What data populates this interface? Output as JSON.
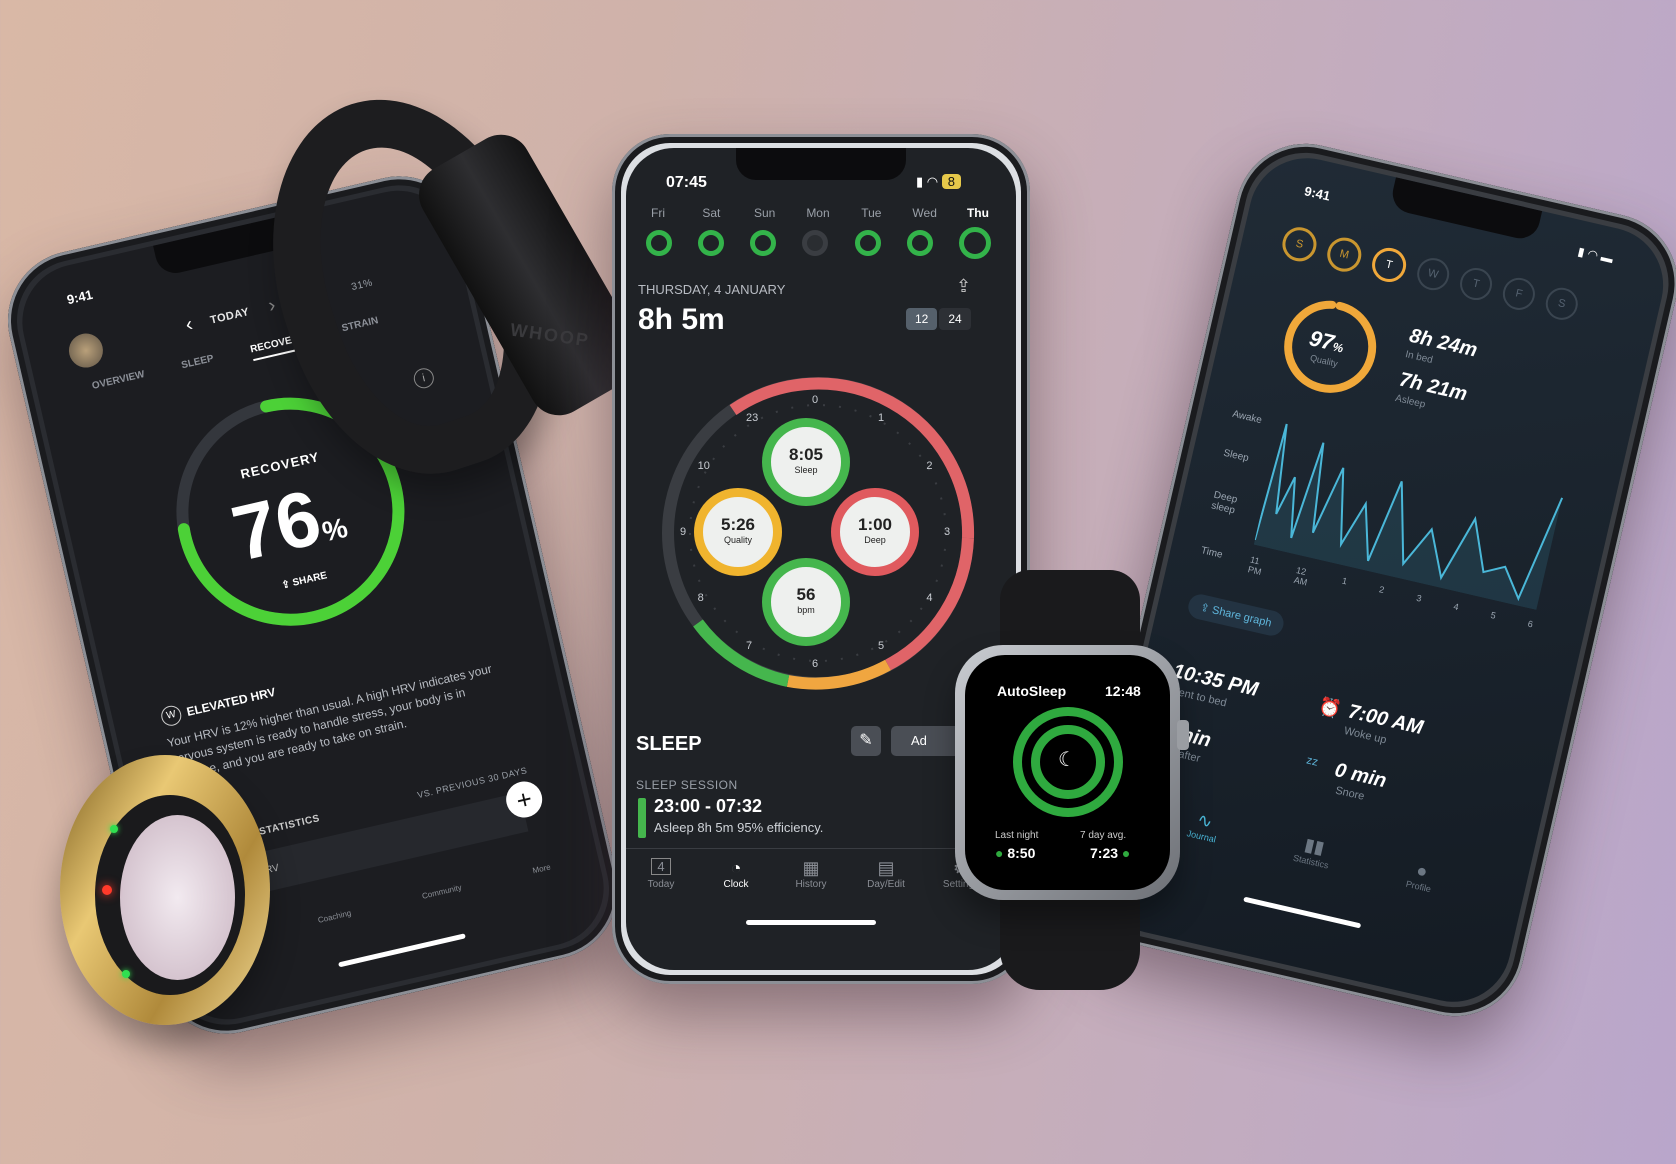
{
  "whoop_phone": {
    "time": "9:41",
    "nav_label": "TODAY",
    "battery": "31%",
    "tabs": [
      "OVERVIEW",
      "SLEEP",
      "RECOVERY",
      "STRAIN"
    ],
    "recovery_label": "RECOVERY",
    "recovery_value": "76",
    "recovery_unit": "%",
    "recovery_fraction": 0.76,
    "share_label": "SHARE",
    "hrv_title": "ELEVATED HRV",
    "hrv_text": "Your HRV is 12% higher than usual. A high HRV indicates your nervous system is ready to handle stress, your body is in balance, and you are ready to take on strain.",
    "stats_label": "RY STATISTICS",
    "stats_compare": "VS. PREVIOUS 30 DAYS",
    "stats_row": "RV",
    "bottom_nav": [
      "ome",
      "Coaching",
      "Community",
      "More"
    ],
    "accent": "#4cd137"
  },
  "band": {
    "brand": "WHOOP"
  },
  "autosleep_phone": {
    "time": "07:45",
    "days": [
      "Fri",
      "Sat",
      "Sun",
      "Mon",
      "Tue",
      "Wed",
      "Thu"
    ],
    "date": "THURSDAY, 4 JANUARY",
    "duration": "8h 5m",
    "toggle": [
      "12",
      "24"
    ],
    "clock_numbers": [
      "0",
      "1",
      "2",
      "3",
      "4",
      "5",
      "6",
      "7",
      "8",
      "9",
      "10",
      "23"
    ],
    "rings": {
      "sleep": {
        "value": "8:05",
        "label": "Sleep"
      },
      "quality": {
        "value": "5:26",
        "label": "Quality"
      },
      "deep": {
        "value": "1:00",
        "label": "Deep"
      },
      "bpm": {
        "value": "56",
        "label": "bpm"
      }
    },
    "section": "SLEEP",
    "add_button": "Ad",
    "session_label": "SLEEP SESSION",
    "session_time": "23:00 - 07:32",
    "session_detail": "Asleep 8h 5m 95% efficiency.",
    "tab_bar": [
      "Today",
      "Clock",
      "History",
      "Day/Edit",
      "Settings"
    ],
    "today_badge": "4"
  },
  "watch": {
    "app": "AutoSleep",
    "time": "12:48",
    "last_label": "Last night",
    "last_value": "8:50",
    "avg_label": "7 day avg.",
    "avg_value": "7:23"
  },
  "right_phone": {
    "time": "9:41",
    "days": [
      "S",
      "M",
      "T",
      "W",
      "T",
      "F",
      "S"
    ],
    "quality_value": "97",
    "quality_unit": "%",
    "quality_label": "Quality",
    "quality_fraction": 0.97,
    "in_bed_value": "8h 24m",
    "in_bed_label": "In bed",
    "asleep_value": "7h 21m",
    "asleep_label": "Asleep",
    "chart_ylabels": [
      "Awake",
      "Sleep",
      "Deep sleep"
    ],
    "chart_xlabel": "Time",
    "chart_ticks": [
      "11 PM",
      "12 AM",
      "1",
      "2",
      "3",
      "4",
      "5",
      "6"
    ],
    "share_graph": "Share graph",
    "bed_value": "10:35 PM",
    "bed_label": "Went to bed",
    "wake_value": "7:00 AM",
    "wake_label": "Woke up",
    "sleep_after_value": "1 min",
    "sleep_after_label": "leep after",
    "snore_value": "0 min",
    "snore_label": "Snore",
    "nav": [
      "Journal",
      "Statistics",
      "Profile"
    ]
  }
}
